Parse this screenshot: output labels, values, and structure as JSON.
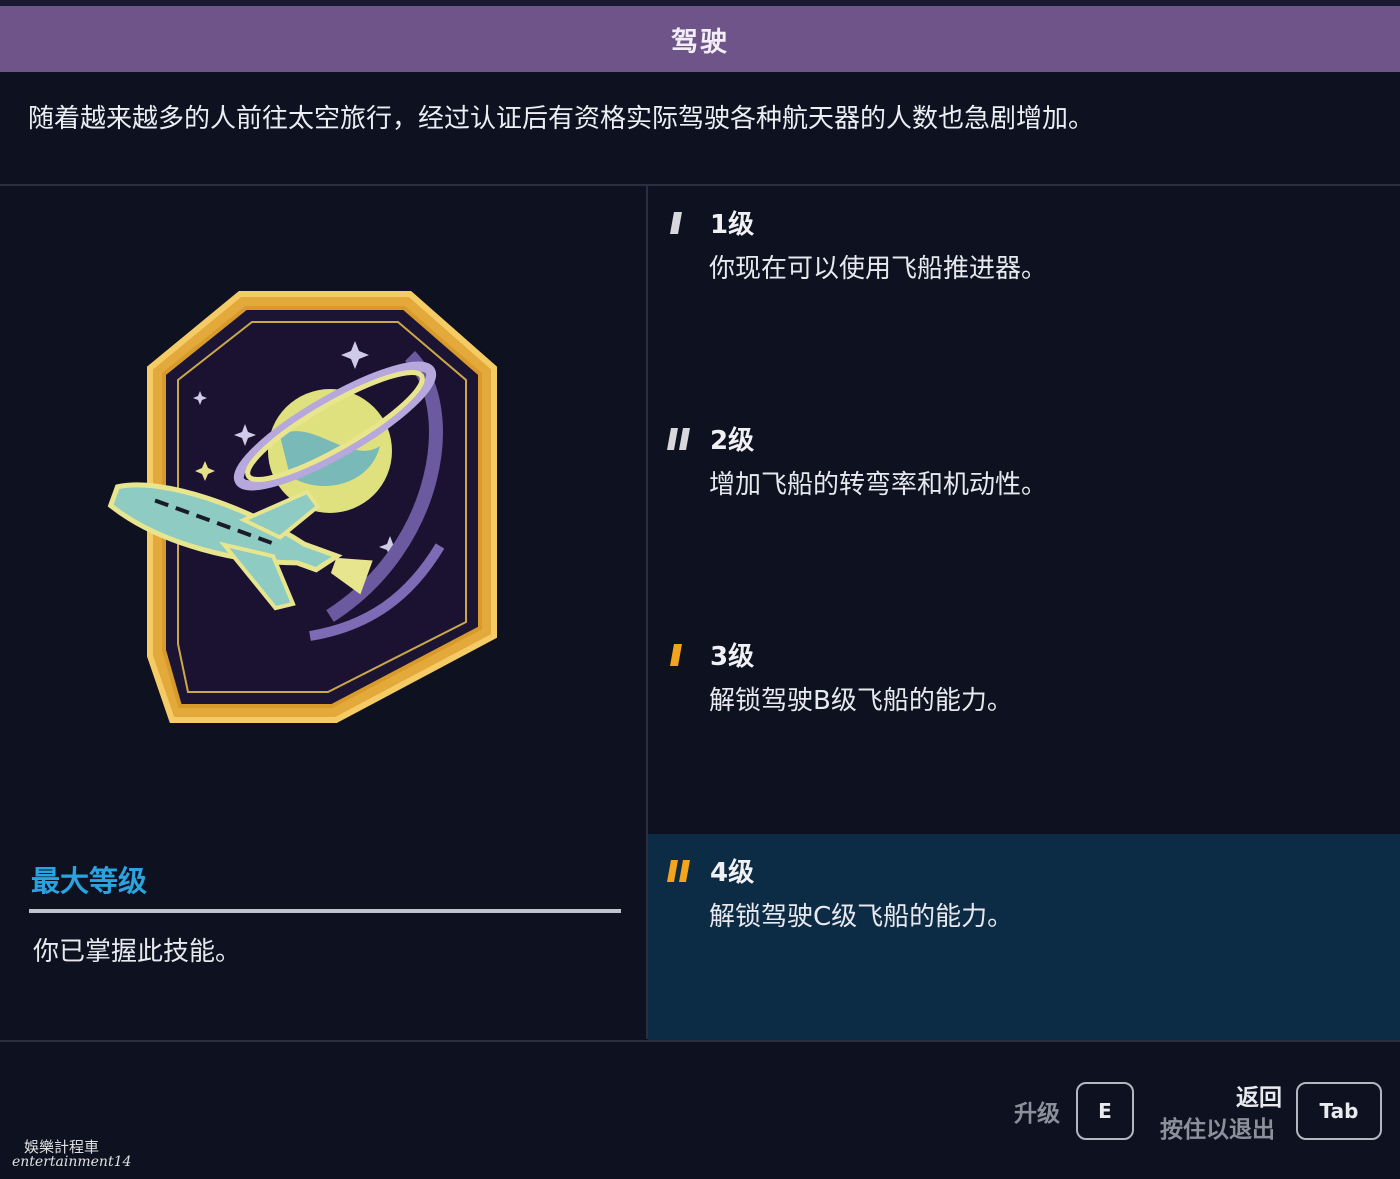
{
  "header": {
    "title": "驾驶"
  },
  "skill": {
    "description": "随着越来越多的人前往太空旅行，经过认证后有资格实际驾驶各种航天器的人数也急剧增加。"
  },
  "left_panel": {
    "badge_icon": "space-shuttle-planet-badge-icon",
    "max_level_label": "最大等级",
    "mastered_text": "你已掌握此技能。"
  },
  "levels": [
    {
      "title": "1级",
      "desc": "你现在可以使用飞船推进器。",
      "marker_color": "#d8d8dc",
      "active": false
    },
    {
      "title": "2级",
      "desc": "增加飞船的转弯率和机动性。",
      "marker_color": "#d8d8dc",
      "active": false
    },
    {
      "title": "3级",
      "desc": "解锁驾驶B级飞船的能力。",
      "marker_color": "#f2a51c",
      "active": false
    },
    {
      "title": "4级",
      "desc": "解锁驾驶C级飞船的能力。",
      "marker_color": "#f2a51c",
      "active": true
    }
  ],
  "footer": {
    "upgrade_label": "升级",
    "upgrade_key": "E",
    "back_label": "返回",
    "hold_exit_label": "按住以退出",
    "back_key": "Tab"
  },
  "watermark": {
    "line1": "娛樂計程車",
    "line2": "entertainment14"
  },
  "colors": {
    "title_bar": "#6e5488",
    "background": "#0d1120",
    "active_level": "#0c2b44",
    "accent_blue": "#2aa3df",
    "marker_orange": "#f2a51c"
  }
}
